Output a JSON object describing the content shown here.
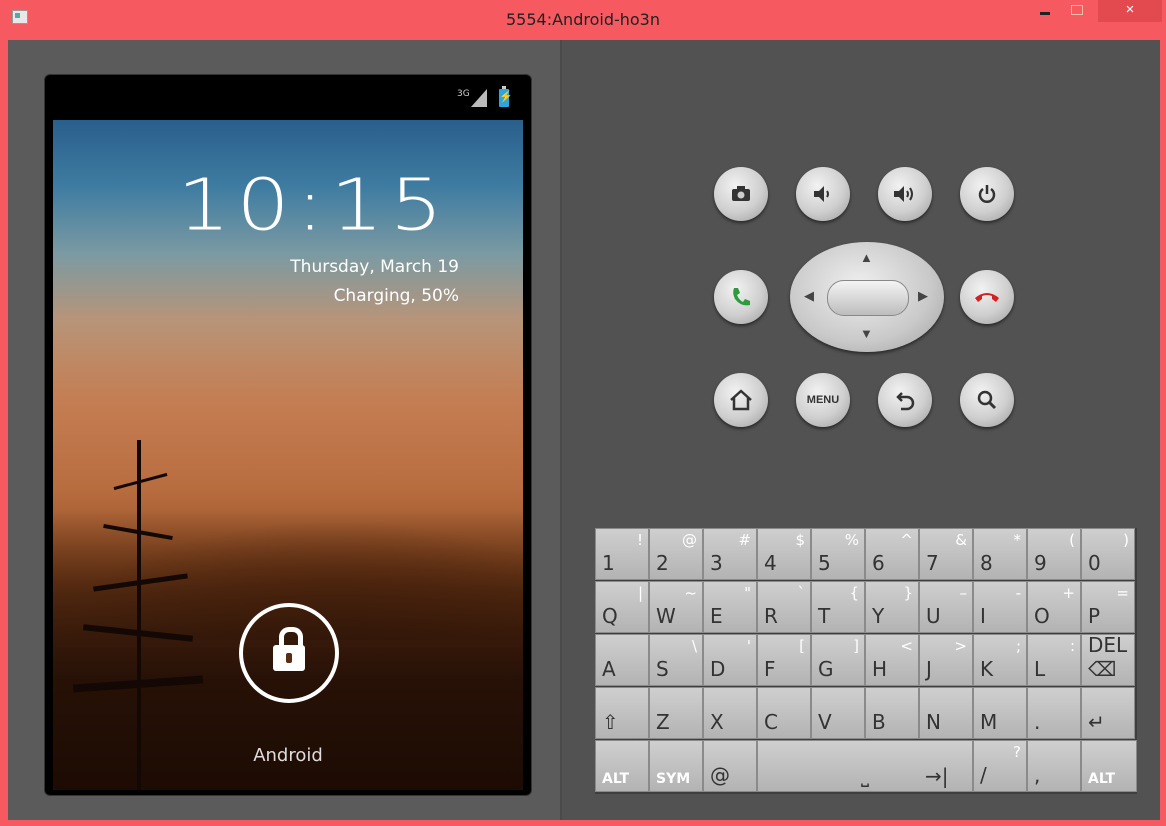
{
  "window": {
    "title": "5554:Android-ho3n",
    "close_label": "×"
  },
  "phone": {
    "status": {
      "network": "3G"
    },
    "lockscreen": {
      "time": "10:15",
      "date": "Thursday, March 19",
      "charging": "Charging, 50%",
      "owner": "Android"
    }
  },
  "controls": {
    "dpad_up": "▲",
    "dpad_down": "▼",
    "dpad_left": "◀",
    "dpad_right": "▶",
    "menu_label": "MENU"
  },
  "keyboard": {
    "row1": [
      {
        "main": "1",
        "alt": "!"
      },
      {
        "main": "2",
        "alt": "@"
      },
      {
        "main": "3",
        "alt": "#"
      },
      {
        "main": "4",
        "alt": "$"
      },
      {
        "main": "5",
        "alt": "%"
      },
      {
        "main": "6",
        "alt": "^"
      },
      {
        "main": "7",
        "alt": "&"
      },
      {
        "main": "8",
        "alt": "*"
      },
      {
        "main": "9",
        "alt": "("
      },
      {
        "main": "0",
        "alt": ")"
      }
    ],
    "row2": [
      {
        "main": "Q",
        "alt": "|"
      },
      {
        "main": "W",
        "alt": "~"
      },
      {
        "main": "E",
        "alt": "\""
      },
      {
        "main": "R",
        "alt": "`"
      },
      {
        "main": "T",
        "alt": "{"
      },
      {
        "main": "Y",
        "alt": "}"
      },
      {
        "main": "U",
        "alt": "–"
      },
      {
        "main": "I",
        "alt": "-"
      },
      {
        "main": "O",
        "alt": "+"
      },
      {
        "main": "P",
        "alt": "="
      }
    ],
    "row3": [
      {
        "main": "A",
        "alt": ""
      },
      {
        "main": "S",
        "alt": "\\"
      },
      {
        "main": "D",
        "alt": "'"
      },
      {
        "main": "F",
        "alt": "["
      },
      {
        "main": "G",
        "alt": "]"
      },
      {
        "main": "H",
        "alt": "<"
      },
      {
        "main": "J",
        "alt": ">"
      },
      {
        "main": "K",
        "alt": ";"
      },
      {
        "main": "L",
        "alt": ":"
      },
      {
        "main": "DEL ⌫",
        "alt": ""
      }
    ],
    "row4": [
      {
        "main": "⇧",
        "alt": ""
      },
      {
        "main": "Z",
        "alt": ""
      },
      {
        "main": "X",
        "alt": ""
      },
      {
        "main": "C",
        "alt": ""
      },
      {
        "main": "V",
        "alt": ""
      },
      {
        "main": "B",
        "alt": ""
      },
      {
        "main": "N",
        "alt": ""
      },
      {
        "main": "M",
        "alt": ""
      },
      {
        "main": ".",
        "alt": ""
      },
      {
        "main": "↵",
        "alt": ""
      }
    ],
    "row5": {
      "alt_left": "ALT",
      "sym": "SYM",
      "at": "@",
      "space": "⎵",
      "tab": "→|",
      "slash": "/",
      "question": "?",
      "comma": ",",
      "alt_right": "ALT"
    }
  },
  "colors": {
    "titlebar": "#f65a60",
    "close": "#e34a4f",
    "battery": "#2aa6e0",
    "call_green": "#2e9a3c",
    "end_red": "#d42020"
  }
}
